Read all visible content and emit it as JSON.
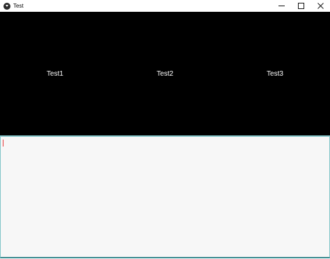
{
  "window": {
    "title": "Test",
    "icon": "kivy-app-icon",
    "controls": {
      "minimize": "minimize-icon",
      "maximize": "maximize-icon",
      "close": "close-icon"
    }
  },
  "tabs": [
    {
      "label": "Test1"
    },
    {
      "label": "Test2"
    },
    {
      "label": "Test3"
    }
  ],
  "text_input": {
    "value": ""
  },
  "colors": {
    "tab_bar_bg": "#000000",
    "tab_text": "#ffffff",
    "input_bg": "#f7f7f7",
    "input_border": "#7fc4c8",
    "caret": "#e43b3b"
  }
}
